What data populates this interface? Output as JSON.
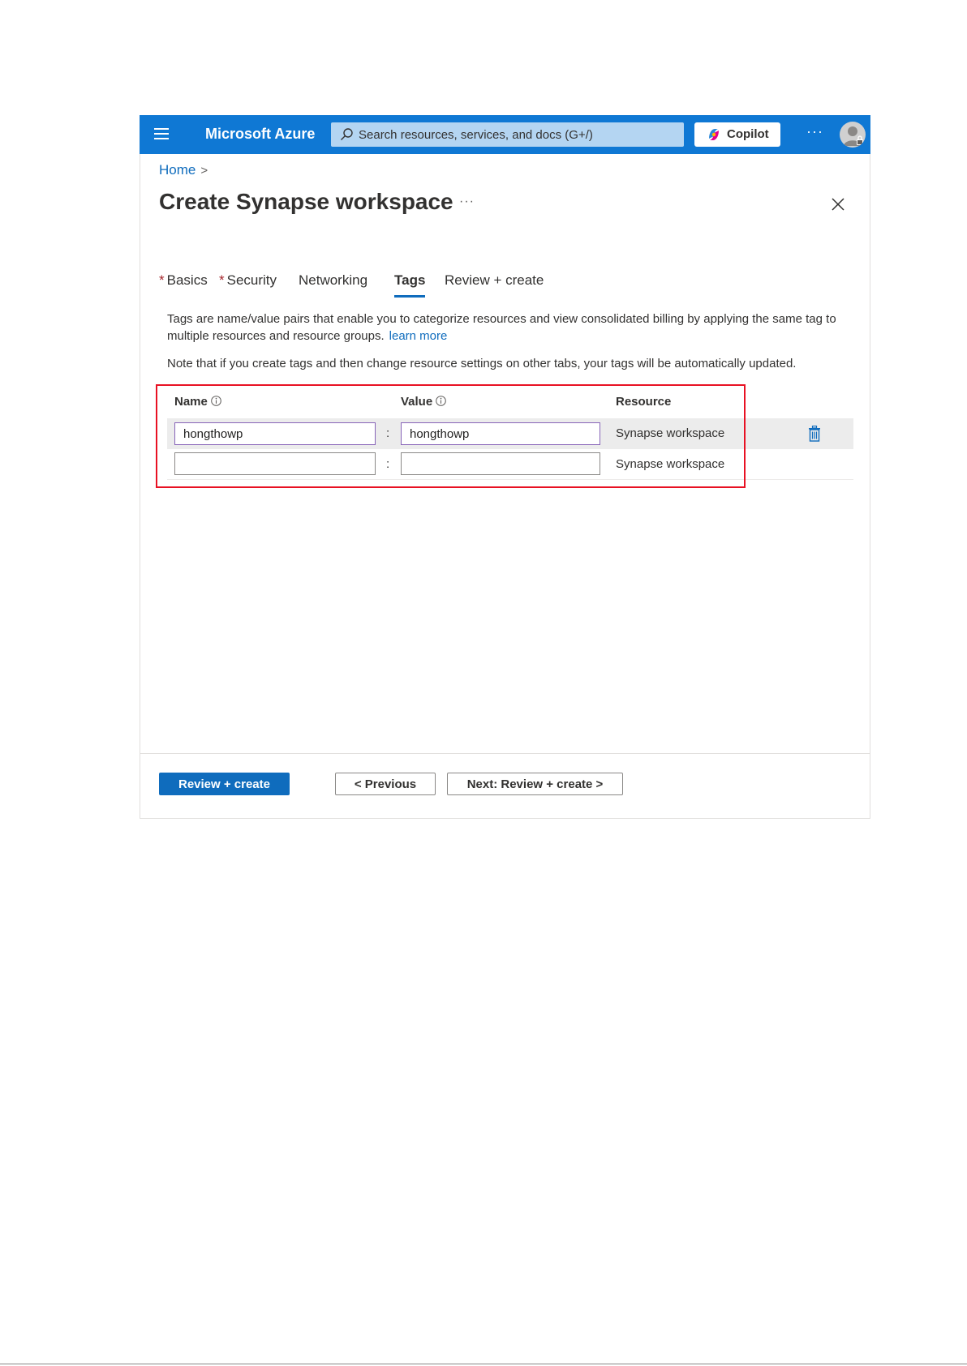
{
  "topbar": {
    "brand": "Microsoft Azure",
    "search_placeholder": "Search resources, services, and docs (G+/)",
    "copilot_label": "Copilot",
    "more_label": "···"
  },
  "breadcrumb": {
    "home": "Home",
    "separator": ">"
  },
  "page": {
    "title": "Create Synapse workspace",
    "more_label": "···"
  },
  "tabs": [
    {
      "label": "Basics",
      "required": "*"
    },
    {
      "label": "Security",
      "required": "*"
    },
    {
      "label": "Networking"
    },
    {
      "label": "Tags",
      "active": true
    },
    {
      "label": "Review + create"
    }
  ],
  "description": {
    "text": "Tags are name/value pairs that enable you to categorize resources and view consolidated billing by applying the same tag to multiple resources and resource groups.",
    "link": "learn more"
  },
  "note": "Note that if you create tags and then change resource settings on other tabs, your tags will be automatically updated.",
  "table": {
    "headers": {
      "name": "Name",
      "value": "Value",
      "resource": "Resource"
    },
    "separator": ":",
    "rows": [
      {
        "name": "hongthowp",
        "value": "hongthowp",
        "resource": "Synapse workspace"
      },
      {
        "name": "",
        "value": "",
        "resource": "Synapse workspace"
      }
    ]
  },
  "footer": {
    "review_create": "Review + create",
    "previous": "< Previous",
    "next": "Next: Review + create >"
  },
  "colors": {
    "accent": "#0f78d4",
    "link": "#0f6cbd",
    "highlight": "#e81123",
    "required": "#a4262c"
  }
}
